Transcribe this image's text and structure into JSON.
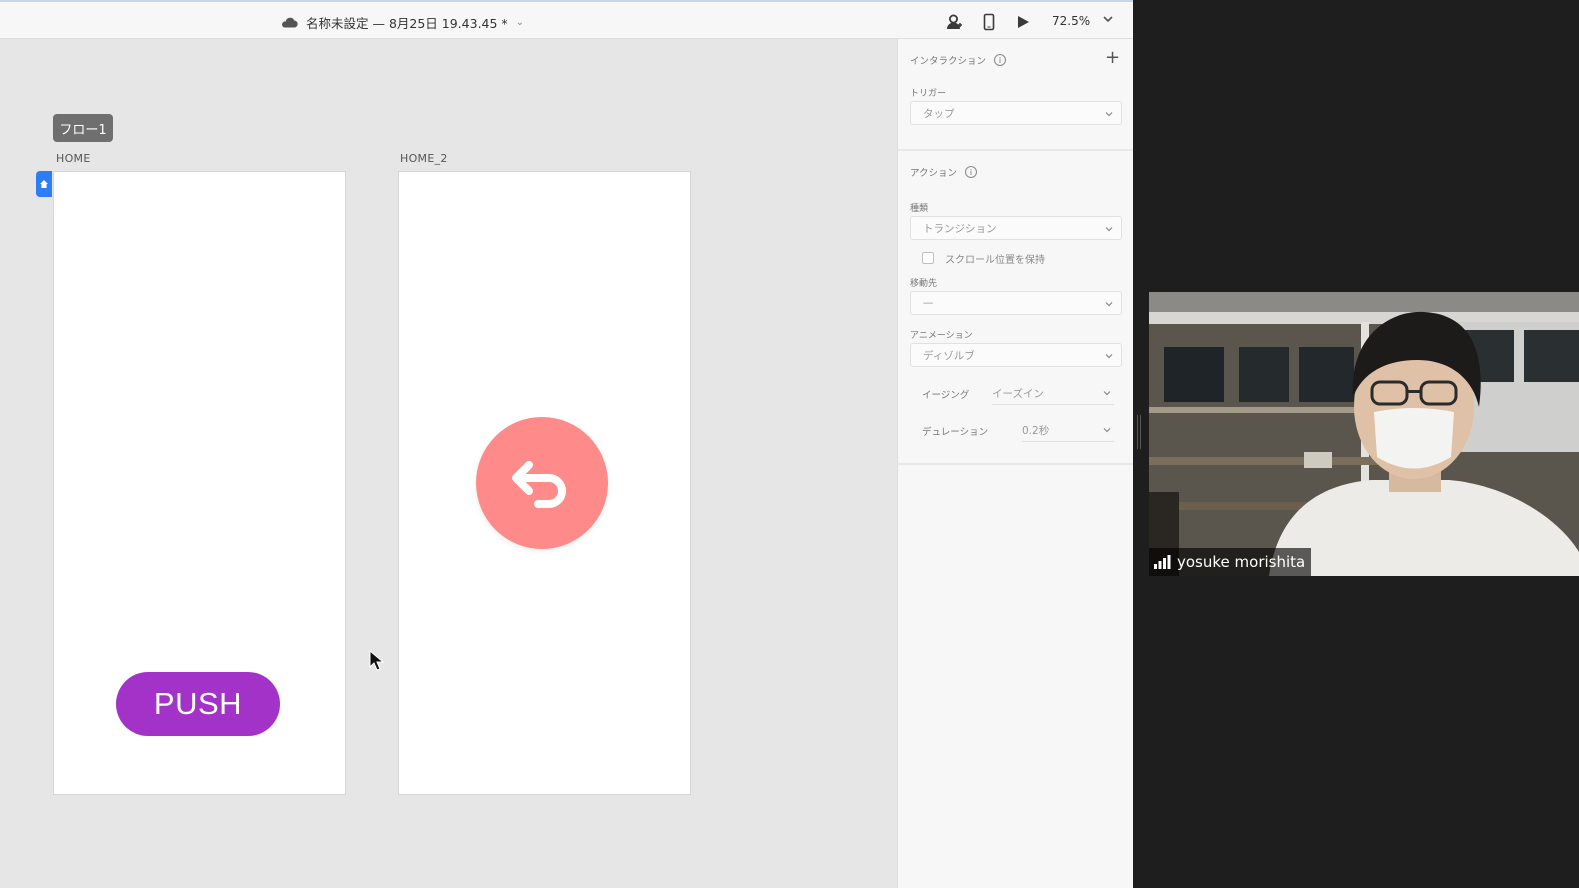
{
  "topbar": {
    "document_title": "名称未設定 — 8月25日 19.43.45 *",
    "zoom": "72.5%"
  },
  "canvas": {
    "flow_badge": "フロー1",
    "artboards": [
      {
        "label": "HOME"
      },
      {
        "label": "HOME_2"
      }
    ],
    "push_button": "PUSH"
  },
  "inspector": {
    "interaction_title": "インタラクション",
    "trigger_label": "トリガー",
    "trigger_value": "タップ",
    "action_title": "アクション",
    "type_label": "種類",
    "type_value": "トランジション",
    "keep_scroll_label": "スクロール位置を保持",
    "destination_label": "移動先",
    "destination_value": "—",
    "animation_label": "アニメーション",
    "animation_value": "ディゾルブ",
    "easing_label": "イージング",
    "easing_value": "イーズイン",
    "duration_label": "デュレーション",
    "duration_value": "0.2秒"
  },
  "video": {
    "participant_name": "yosuke morishita"
  },
  "colors": {
    "push_button": "#a232c8",
    "back_circle": "#ff8a8a",
    "home_flag": "#2d7df6"
  }
}
